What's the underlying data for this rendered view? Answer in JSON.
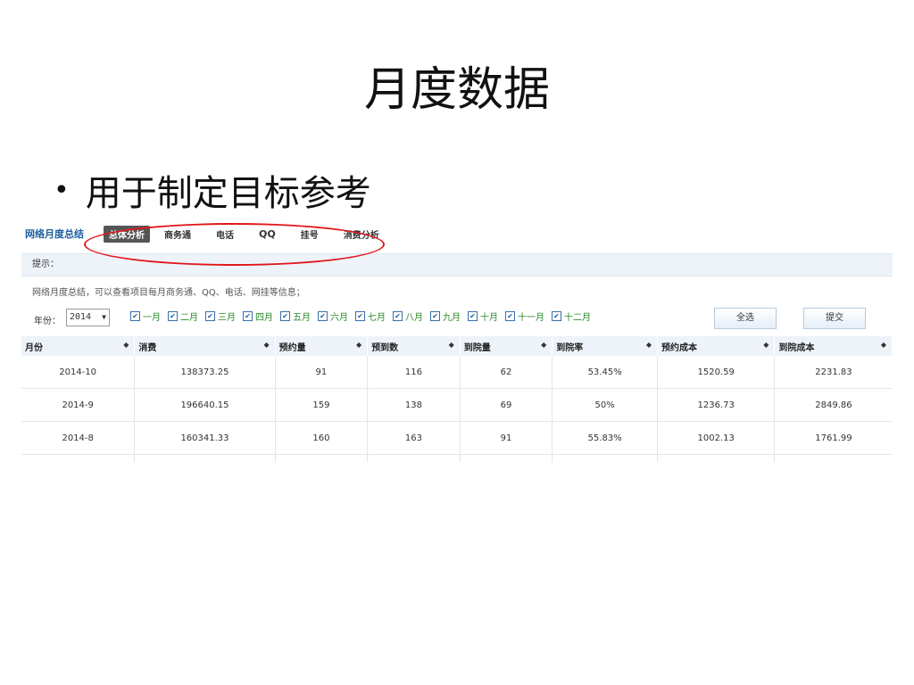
{
  "slide": {
    "title": "月度数据",
    "bullet": "用于制定目标参考"
  },
  "app": {
    "brand": "网络月度总结",
    "tabs": [
      "总体分析",
      "商务通",
      "电话",
      "QQ",
      "挂号",
      "消费分析"
    ],
    "hint_label": "提示：",
    "hint_text": "网络月度总结，可以查看项目每月商务通、QQ、电话、网挂等信息；",
    "year_label": "年份：",
    "year_value": "2014",
    "months": [
      "一月",
      "二月",
      "三月",
      "四月",
      "五月",
      "六月",
      "七月",
      "八月",
      "九月",
      "十月",
      "十一月",
      "十二月"
    ],
    "select_all": "全选",
    "submit": "提交",
    "columns": [
      "月份",
      "消费",
      "预约量",
      "预到数",
      "到院量",
      "到院率",
      "预约成本",
      "到院成本"
    ],
    "rows": [
      [
        "2014-10",
        "138373.25",
        "91",
        "116",
        "62",
        "53.45%",
        "1520.59",
        "2231.83"
      ],
      [
        "2014-9",
        "196640.15",
        "159",
        "138",
        "69",
        "50%",
        "1236.73",
        "2849.86"
      ],
      [
        "2014-8",
        "160341.33",
        "160",
        "163",
        "91",
        "55.83%",
        "1002.13",
        "1761.99"
      ]
    ]
  },
  "colors": {
    "annotation": "#e0171b",
    "brand": "#1f5f9f",
    "month_label": "#2a8a2a"
  }
}
